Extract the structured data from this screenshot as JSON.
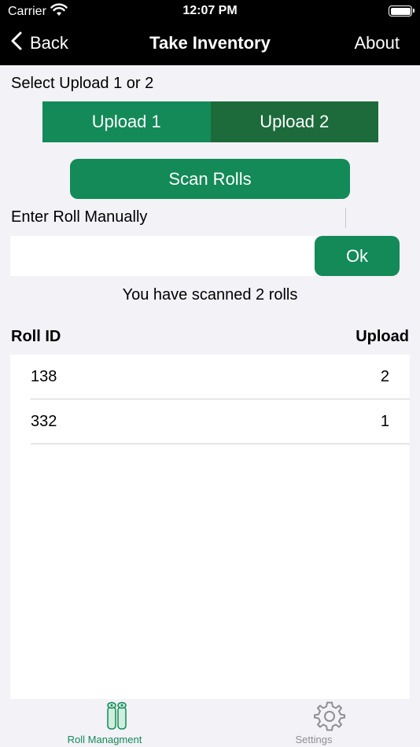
{
  "status": {
    "carrier": "Carrier",
    "time": "12:07 PM"
  },
  "nav": {
    "back_label": "Back",
    "title": "Take Inventory",
    "about_label": "About"
  },
  "upload_select": {
    "label": "Select Upload 1 or 2",
    "option1": "Upload 1",
    "option2": "Upload 2",
    "selected": "Upload 2"
  },
  "scan_button": "Scan Rolls",
  "manual": {
    "label": "Enter Roll Manually",
    "value": "",
    "ok_label": "Ok"
  },
  "scanned_message": "You have scanned 2 rolls",
  "table": {
    "col_roll_id": "Roll ID",
    "col_upload": "Upload",
    "rows": [
      {
        "roll_id": "138",
        "upload": "2"
      },
      {
        "roll_id": "332",
        "upload": "1"
      }
    ]
  },
  "tabs": {
    "tab1": "Roll Managment",
    "tab2": "Settings",
    "active": "Roll Managment"
  },
  "colors": {
    "accent": "#138a58",
    "selected_segment": "#1d6a3b",
    "background": "#f2f2f7"
  }
}
